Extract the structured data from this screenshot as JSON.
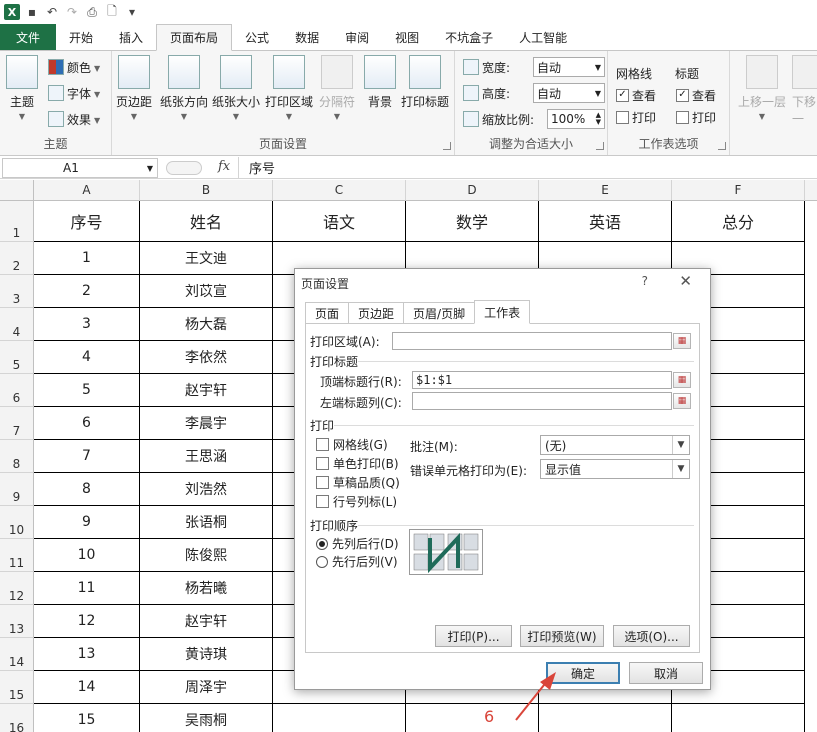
{
  "ribbon_tabs": [
    "文件",
    "开始",
    "插入",
    "页面布局",
    "公式",
    "数据",
    "审阅",
    "视图",
    "不坑盒子",
    "人工智能"
  ],
  "active_tab": "页面布局",
  "ribbon": {
    "theme": {
      "label": "主题",
      "big": "主题",
      "colors": "颜色",
      "fonts": "字体",
      "effects": "效果"
    },
    "page_setup": {
      "label": "页面设置",
      "margins": "页边距",
      "orientation": "纸张方向",
      "size": "纸张大小",
      "print_area": "打印区域",
      "breaks": "分隔符",
      "background": "背景",
      "print_titles": "打印标题"
    },
    "scale_to_fit": {
      "label": "调整为合适大小",
      "width_label": "宽度:",
      "width_value": "自动",
      "height_label": "高度:",
      "height_value": "自动",
      "scale_label": "缩放比例:",
      "scale_value": "100%"
    },
    "sheet_options": {
      "label": "工作表选项",
      "gridlines": "网格线",
      "headings": "标题",
      "view": "查看",
      "print": "打印"
    },
    "arrange": {
      "bring_forward": "上移一层",
      "send_backward": "下移一"
    }
  },
  "formula_bar": {
    "name_box": "A1",
    "fx": "fx",
    "content": "序号"
  },
  "columns": [
    "A",
    "B",
    "C",
    "D",
    "E",
    "F"
  ],
  "headers": [
    "序号",
    "姓名",
    "语文",
    "数学",
    "英语",
    "总分"
  ],
  "rows": [
    {
      "n": "1",
      "name": "王文迪"
    },
    {
      "n": "2",
      "name": "刘苡宣"
    },
    {
      "n": "3",
      "name": "杨大磊"
    },
    {
      "n": "4",
      "name": "李依然"
    },
    {
      "n": "5",
      "name": "赵宇轩"
    },
    {
      "n": "6",
      "name": "李晨宇"
    },
    {
      "n": "7",
      "name": "王思涵"
    },
    {
      "n": "8",
      "name": "刘浩然"
    },
    {
      "n": "9",
      "name": "张语桐"
    },
    {
      "n": "10",
      "name": "陈俊熙"
    },
    {
      "n": "11",
      "name": "杨若曦"
    },
    {
      "n": "12",
      "name": "赵宇轩"
    },
    {
      "n": "13",
      "name": "黄诗琪"
    },
    {
      "n": "14",
      "name": "周泽宇"
    },
    {
      "n": "15",
      "name": "吴雨桐"
    }
  ],
  "row_numbers": [
    "1",
    "2",
    "3",
    "4",
    "5",
    "6",
    "7",
    "8",
    "9",
    "10",
    "11",
    "12",
    "13",
    "14",
    "15",
    "16"
  ],
  "dialog": {
    "title": "页面设置",
    "help": "?",
    "close": "✕",
    "tabs": [
      "页面",
      "页边距",
      "页眉/页脚",
      "工作表"
    ],
    "active_tab": "工作表",
    "print_area_label": "打印区域(A):",
    "print_area_value": "",
    "print_titles_label": "打印标题",
    "top_rows_label": "顶端标题行(R):",
    "top_rows_value": "$1:$1",
    "left_cols_label": "左端标题列(C):",
    "left_cols_value": "",
    "print_label": "打印",
    "gridlines": "网格线(G)",
    "bw": "单色打印(B)",
    "draft": "草稿品质(Q)",
    "headings": "行号列标(L)",
    "comments_label": "批注(M):",
    "comments_value": "(无)",
    "errors_label": "错误单元格打印为(E):",
    "errors_value": "显示值",
    "order_label": "打印顺序",
    "down_then_over": "先列后行(D)",
    "over_then_down": "先行后列(V)",
    "btn_print": "打印(P)...",
    "btn_preview": "打印预览(W)",
    "btn_options": "选项(O)...",
    "btn_ok": "确定",
    "btn_cancel": "取消"
  },
  "annotation": {
    "number": "6",
    "color": "#d9453a"
  },
  "colors": {
    "excel_green": "#1e7145",
    "focus_blue": "#3c7fb1"
  }
}
